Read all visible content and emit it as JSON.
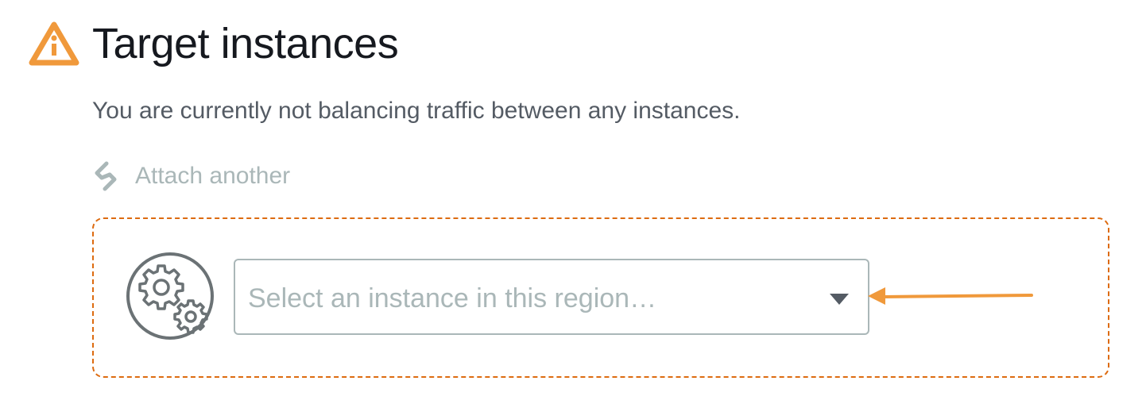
{
  "header": {
    "title": "Target instances",
    "icon": "warning-icon",
    "icon_color": "#f0993b"
  },
  "status": {
    "message": "You are currently not balancing traffic between any instances."
  },
  "attach": {
    "label": "Attach another",
    "icon": "link-icon",
    "state": "disabled"
  },
  "instance_picker": {
    "icon": "gears-icon",
    "placeholder": "Select an instance in this region…",
    "dropdown_icon": "caret-down-icon"
  },
  "annotation": {
    "icon": "arrow-left-icon",
    "color": "#f0993b"
  },
  "colors": {
    "box_border": "#dd6b10",
    "text_primary": "#16191f",
    "text_secondary": "#545b64",
    "text_disabled": "#aab7b8"
  }
}
